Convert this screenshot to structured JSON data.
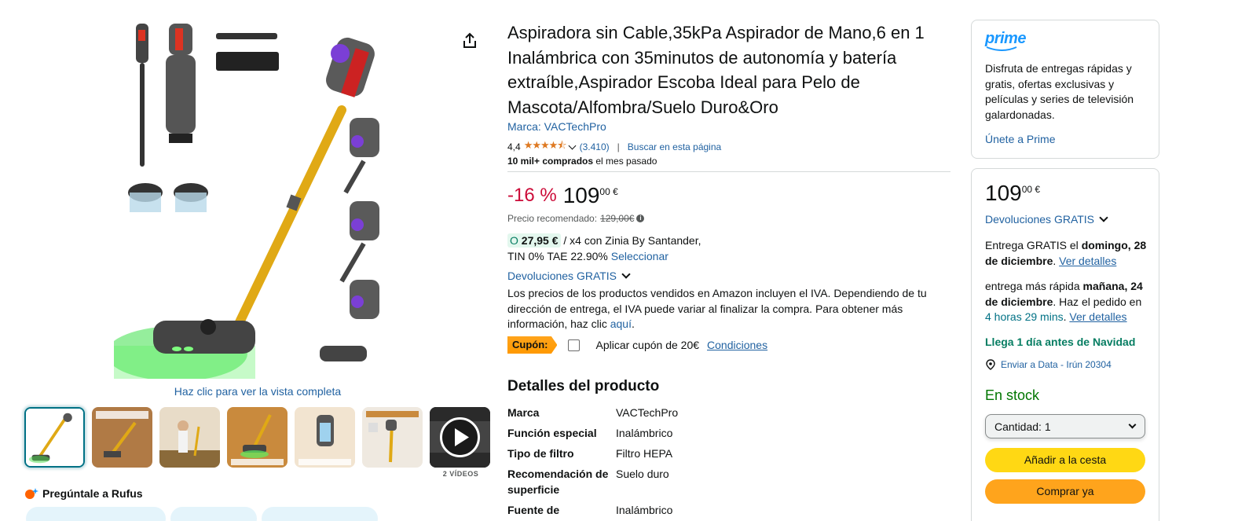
{
  "gallery": {
    "zoom_hint": "Haz clic para ver la vista completa",
    "videos_label": "2 VÍDEOS",
    "rufus_label": "Pregúntale a Rufus"
  },
  "product": {
    "title": "Aspiradora sin Cable,35kPa Aspirador de Mano,6 en 1 Inalámbrica con 35minutos de autonomía y batería extraíble,Aspirador Escoba Ideal para Pelo de Mascota/Alfombra/Suelo Duro&Oro",
    "brand": "Marca: VACTechPro",
    "rating": "4,4",
    "stars": "★★★★⯪",
    "review_count": "(3.410)",
    "search_page": "Buscar en esta página",
    "bought_bold": "10 mil+ comprados",
    "bought_rest": " el mes pasado"
  },
  "pricing": {
    "discount": "-16 %",
    "whole": "109",
    "fraction": "00 €",
    "rrp_label": "Precio recomendado:",
    "rrp_value": "129,00€",
    "finance_amount": "27,95 €",
    "finance_text": " / x4 con Zinia By Santander,",
    "finance_line2": "TIN 0% TAE 22.90%",
    "finance_select": "Seleccionar",
    "returns": "Devoluciones GRATIS",
    "vat_text": "Los precios de los productos vendidos en Amazon incluyen el IVA. Dependiendo de tu dirección de entrega, el IVA puede variar al finalizar la compra. Para obtener más información, haz clic ",
    "vat_link": "aquí",
    "coupon_tag": "Cupón:",
    "coupon_text": "Aplicar cupón de 20€",
    "coupon_link": "Condiciones"
  },
  "details": {
    "heading": "Detalles del producto",
    "rows": [
      {
        "key": "Marca",
        "value": "VACTechPro"
      },
      {
        "key": "Función especial",
        "value": "Inalámbrico"
      },
      {
        "key": "Tipo de filtro",
        "value": "Filtro HEPA"
      },
      {
        "key": "Recomendación de superficie",
        "value": "Suelo duro"
      },
      {
        "key": "Fuente de",
        "value": "Inalámbrico"
      }
    ]
  },
  "prime": {
    "logo": "prime",
    "text": "Disfruta de entregas rápidas y gratis, ofertas exclusivas y películas y series de televisión galardonadas.",
    "join": "Únete a Prime"
  },
  "buybox": {
    "whole": "109",
    "fraction": "00 €",
    "returns": "Devoluciones GRATIS",
    "delivery_pre": "Entrega GRATIS el ",
    "delivery_date": "domingo, 28 de diciembre",
    "delivery_link": "Ver detalles",
    "fast_pre": "entrega más rápida ",
    "fast_date": "mañana, 24 de diciembre",
    "fast_mid": ". Haz el pedido en ",
    "fast_time": "4 horas 29 mins",
    "fast_link": "Ver detalles",
    "christmas": "Llega 1 día antes de Navidad",
    "location": "Enviar a Data - Irún 20304",
    "stock": "En stock",
    "qty_label": "Cantidad:",
    "qty_value": "1",
    "add_to_cart": "Añadir a la cesta",
    "buy_now": "Comprar ya"
  },
  "colors": {
    "link": "#2162a1",
    "discount": "#cc0c39",
    "stock": "#007600",
    "cart_button": "#ffd814",
    "buy_button": "#ffa41c",
    "prime": "#1a98ff"
  }
}
